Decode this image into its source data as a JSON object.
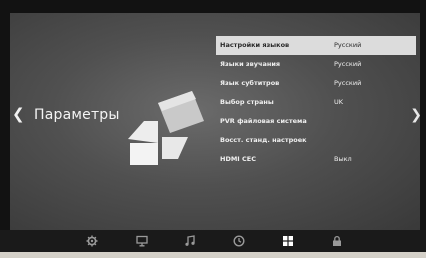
{
  "section": {
    "back_arrow": "❮",
    "title": "Параметры",
    "next_arrow": "❯"
  },
  "menu": {
    "items": [
      {
        "label": "Настройки языков",
        "value": "Русский",
        "selected": true
      },
      {
        "label": "Языки звучания",
        "value": "Русский",
        "selected": false
      },
      {
        "label": "Язык субтитров",
        "value": "Русский",
        "selected": false
      },
      {
        "label": "Выбор страны",
        "value": "UK",
        "selected": false
      },
      {
        "label": "PVR файловая система",
        "value": "",
        "selected": false
      },
      {
        "label": "Восст. станд. настроек",
        "value": "",
        "selected": false
      },
      {
        "label": "HDMI CEC",
        "value": "Выкл",
        "selected": false
      }
    ]
  },
  "dock": {
    "icons": [
      {
        "name": "gear-icon",
        "active": false
      },
      {
        "name": "monitor-icon",
        "active": false
      },
      {
        "name": "music-note-icon",
        "active": false
      },
      {
        "name": "clock-icon",
        "active": false
      },
      {
        "name": "grid-icon",
        "active": true
      },
      {
        "name": "lock-icon",
        "active": false
      }
    ]
  },
  "colors": {
    "screen_bg": "#505050",
    "selected_row_bg": "#dcdcdc",
    "text": "#f0f0f0",
    "bezel": "#121212"
  }
}
